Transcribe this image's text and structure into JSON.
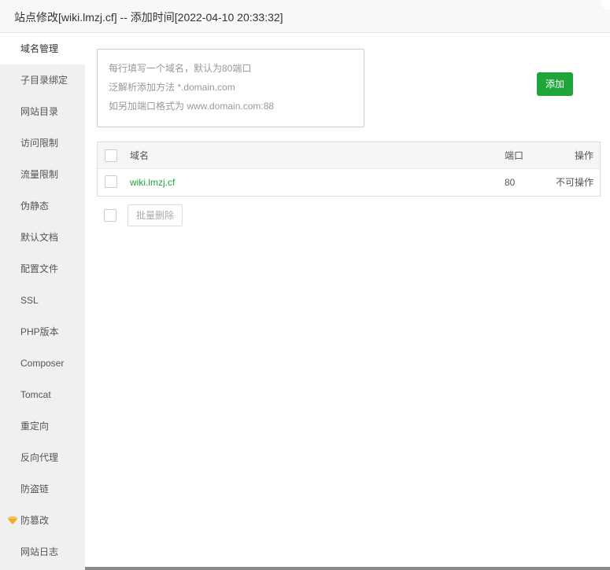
{
  "dialog": {
    "title": "站点修改[wiki.lmzj.cf] -- 添加时间[2022-04-10 20:33:32]"
  },
  "sidebar": {
    "items": [
      {
        "label": "域名管理"
      },
      {
        "label": "子目录绑定"
      },
      {
        "label": "网站目录"
      },
      {
        "label": "访问限制"
      },
      {
        "label": "流量限制"
      },
      {
        "label": "伪静态"
      },
      {
        "label": "默认文档"
      },
      {
        "label": "配置文件"
      },
      {
        "label": "SSL"
      },
      {
        "label": "PHP版本"
      },
      {
        "label": "Composer"
      },
      {
        "label": "Tomcat"
      },
      {
        "label": "重定向"
      },
      {
        "label": "反向代理"
      },
      {
        "label": "防盗链"
      },
      {
        "label": "防篡改",
        "icon": "gem-icon"
      },
      {
        "label": "网站日志"
      }
    ]
  },
  "domain_input": {
    "placeholder_lines": [
      "每行填写一个域名，默认为80端口",
      "泛解析添加方法 *.domain.com",
      "如另加端口格式为 www.domain.com:88"
    ]
  },
  "add_button_label": "添加",
  "table": {
    "columns": [
      "域名",
      "端口",
      "操作"
    ],
    "rows": [
      {
        "domain": "wiki.lmzj.cf",
        "port": "80",
        "action": "不可操作"
      }
    ]
  },
  "batch_delete_label": "批量删除",
  "colors": {
    "accent": "#20a53a",
    "sidebar_bg": "#f0f0f0",
    "gem": "#f5a623"
  }
}
